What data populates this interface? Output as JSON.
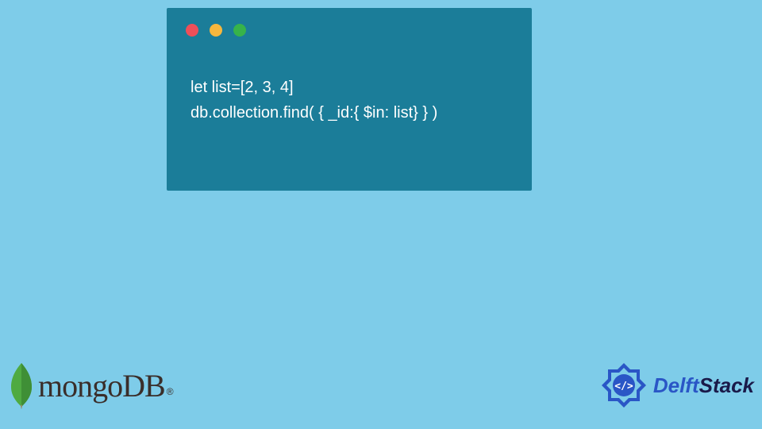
{
  "code": {
    "line1": "let list=[2, 3, 4]",
    "line2": "db.collection.find( { _id:{ $in: list} } )"
  },
  "window": {
    "dot_colors": [
      "#ee4f59",
      "#f7b73d",
      "#37b34a"
    ]
  },
  "footer": {
    "mongo": {
      "text": "mongoDB",
      "registered": "®"
    },
    "delft": {
      "part1": "Delft",
      "part2": "Stack"
    }
  },
  "colors": {
    "background": "#7ecce9",
    "window_bg": "#1b7d99",
    "code_text": "#ffffff",
    "mongo_leaf": "#4faa41",
    "delft_blue": "#2a56c6"
  }
}
